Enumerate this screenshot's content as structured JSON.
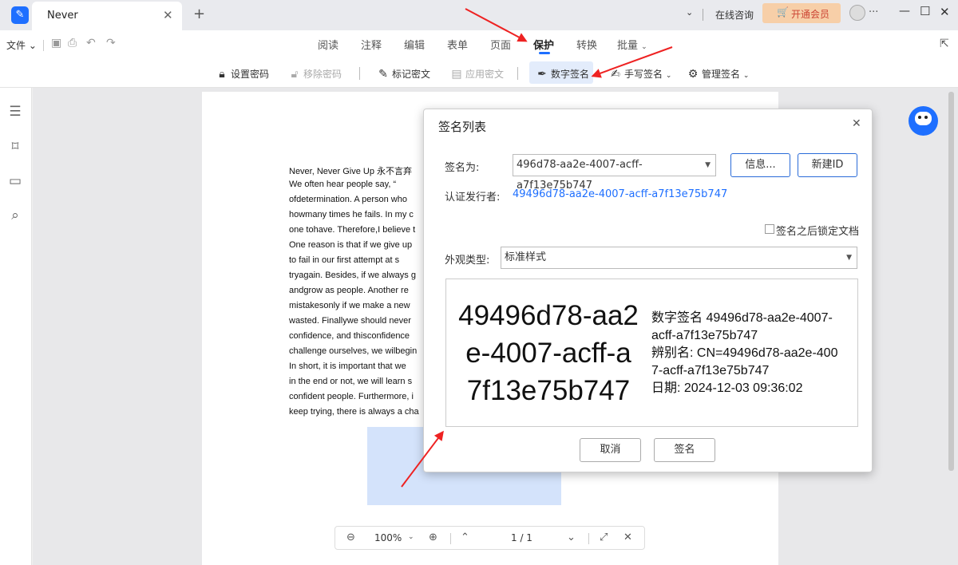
{
  "titlebar": {
    "tab_title": "Never",
    "online_consult": "在线咨询",
    "vip_button": "开通会员",
    "more": "···"
  },
  "menu": {
    "file": "文件",
    "tabs": [
      "阅读",
      "注释",
      "编辑",
      "表单",
      "页面",
      "保护",
      "转换",
      "批量"
    ],
    "active_tab": "保护"
  },
  "toolbar": {
    "set_password": "设置密码",
    "remove_password": "移除密码",
    "mark_redact": "标记密文",
    "apply_redact": "应用密文",
    "digital_signature": "数字签名",
    "handwritten_signature": "手写签名",
    "manage_signature": "管理签名"
  },
  "document": {
    "lines": [
      "Never, Never Give Up  永不言弃",
      "We  often  hear  people  say,  “",
      "ofdetermination. A person who",
      "howmany times he fails. In my c",
      "one tohave. Therefore,I believe t",
      "One reason is that if we give up",
      "to fail in our first attempt at s",
      "tryagain. Besides, if we always g",
      "andgrow as people. Another re",
      "mistakesonly if we make a new",
      "wasted. Finallywe should never",
      "confidence, and  thisconfidence",
      "challenge ourselves, we wilbegin",
      "In short, it is important that we",
      "in the end or not, we will learn s",
      "confident people. Furthermore, i",
      "keep trying, there is always a cha"
    ]
  },
  "dialog": {
    "title": "签名列表",
    "sign_as_label": "签名为:",
    "sign_as_value": "496d78-aa2e-4007-acff-a7f13e75b747",
    "info_button": "信息...",
    "new_id_button": "新建ID",
    "issuer_label": "认证发行者:",
    "issuer_value": "49496d78-aa2e-4007-acff-a7f13e75b747",
    "lock_after_sign": "签名之后锁定文档",
    "appearance_label": "外观类型:",
    "appearance_value": "标准样式",
    "preview_big": [
      "49496d78-aa2",
      "e-4007-acff-a",
      "7f13e75b747"
    ],
    "preview_details": [
      "数字签名 49496d78-aa2e-4007-",
      "acff-a7f13e75b747",
      "辨别名: CN=49496d78-aa2e-400",
      "7-acff-a7f13e75b747",
      "日期: 2024-12-03 09:36:02"
    ],
    "cancel_button": "取消",
    "sign_button": "签名"
  },
  "bottombar": {
    "zoom": "100%",
    "page": "1 / 1"
  },
  "colors": {
    "accent": "#1e6fff",
    "vip": "#f7cfa8",
    "arrow": "#e22222"
  }
}
